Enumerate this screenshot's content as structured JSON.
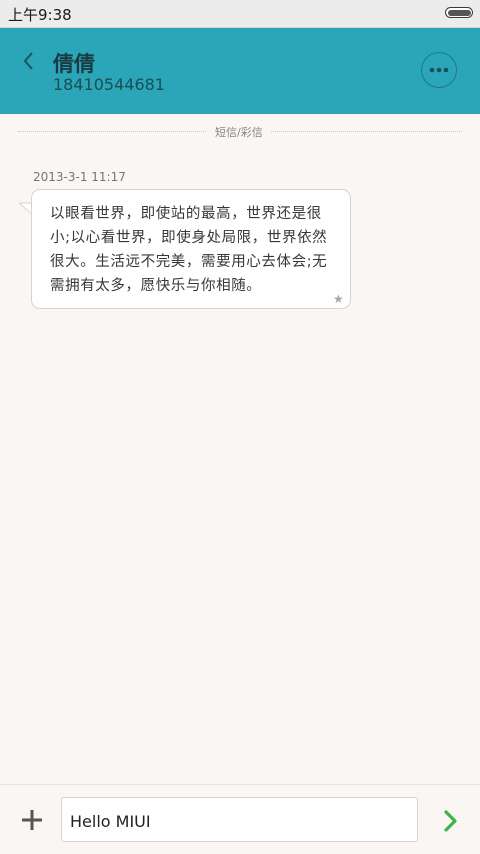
{
  "status_bar": {
    "time": "上午9:38",
    "battery_icon": "battery-icon"
  },
  "header": {
    "back_icon": "back-chevron-icon",
    "contact_name": "倩倩",
    "contact_number": "18410544681",
    "more_icon": "more-dots-icon",
    "background_color": "#2aa6b8"
  },
  "thread": {
    "divider_label": "短信/彩信",
    "messages": [
      {
        "time": "2013-3-1 11:17",
        "lines": [
          "以眼看世界，即使站的最高，世界还是很",
          "小;以心看世界，即使身处局限，世界依然",
          "很大。生活远不完美，需要用心去体会;无",
          "需拥有太多，愿快乐与你相随。"
        ],
        "star_icon": "star-icon"
      }
    ]
  },
  "compose": {
    "add_icon": "plus-icon",
    "input_value": "Hello MIUI",
    "send_icon": "send-arrow-icon",
    "send_color": "#3bb54a"
  }
}
